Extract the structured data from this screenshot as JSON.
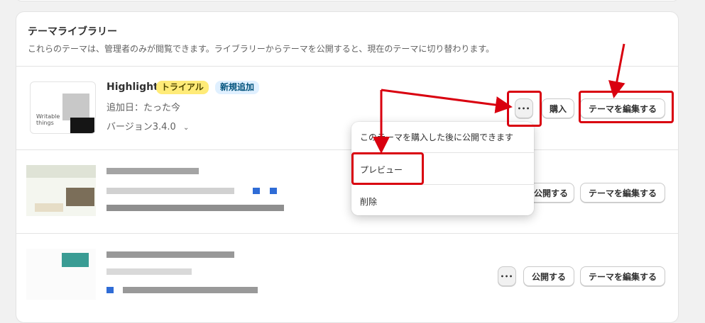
{
  "library": {
    "title": "テーマライブラリー",
    "subtitle": "これらのテーマは、管理者のみが閲覧できます。ライブラリーからテーマを公開すると、現在のテーマに切り替わります。"
  },
  "themes": [
    {
      "name": "Highlight",
      "badges": [
        "トライアル",
        "新規追加"
      ],
      "added": "追加日：たった今",
      "version": "バージョン3.4.0",
      "thumb_text": "Writable things",
      "buttons": {
        "more": "•••",
        "buy": "購入",
        "edit": "テーマを編集する"
      }
    },
    {
      "buttons": {
        "publish": "公開する",
        "edit": "テーマを編集する"
      }
    },
    {
      "buttons": {
        "more": "•••",
        "publish": "公開する",
        "edit": "テーマを編集する"
      }
    }
  ],
  "menu": {
    "items": [
      "このテーマを購入した後に公開できます",
      "プレビュー",
      "削除"
    ]
  },
  "colors": {
    "highlight": "#d9000f",
    "trial_badge": "#ffeb78",
    "new_badge": "#e0f0ff"
  },
  "icons": {
    "more": "ellipsis-icon",
    "version": "chevron-down-icon"
  }
}
